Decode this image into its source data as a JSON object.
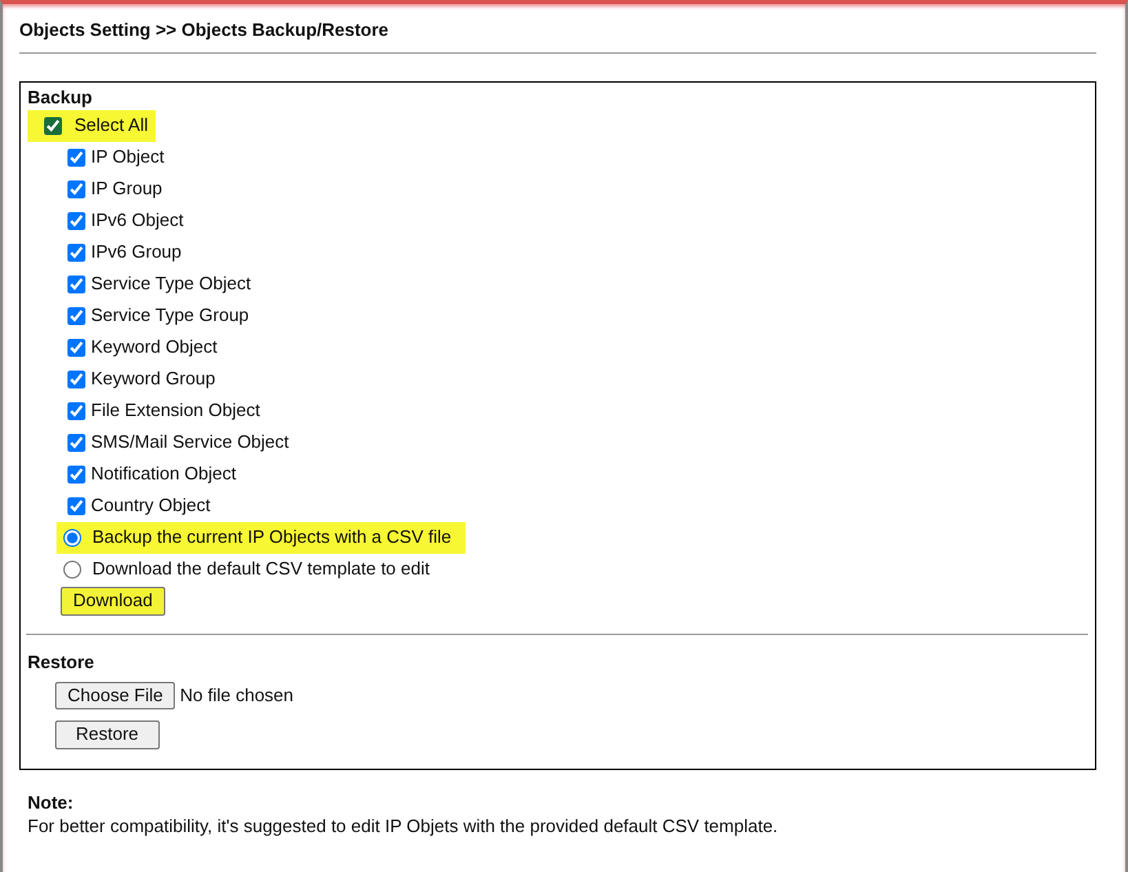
{
  "page_title": "Objects Setting >> Objects Backup/Restore",
  "backup": {
    "heading": "Backup",
    "select_all": {
      "label": "Select All",
      "checked": true,
      "highlighted": true
    },
    "objects": [
      {
        "label": "IP Object",
        "checked": true
      },
      {
        "label": "IP Group",
        "checked": true
      },
      {
        "label": "IPv6 Object",
        "checked": true
      },
      {
        "label": "IPv6 Group",
        "checked": true
      },
      {
        "label": "Service Type Object",
        "checked": true
      },
      {
        "label": "Service Type Group",
        "checked": true
      },
      {
        "label": "Keyword Object",
        "checked": true
      },
      {
        "label": "Keyword Group",
        "checked": true
      },
      {
        "label": "File Extension Object",
        "checked": true
      },
      {
        "label": "SMS/Mail Service Object",
        "checked": true
      },
      {
        "label": "Notification Object",
        "checked": true
      },
      {
        "label": "Country Object",
        "checked": true
      }
    ],
    "options": [
      {
        "label": "Backup the current IP Objects with a CSV file",
        "selected": true,
        "highlighted": true
      },
      {
        "label": "Download the default CSV template to edit",
        "selected": false,
        "highlighted": false
      }
    ],
    "download_button": {
      "label": "Download",
      "highlighted": true
    }
  },
  "restore": {
    "heading": "Restore",
    "choose_button": "Choose File",
    "file_status": "No file chosen",
    "restore_button": "Restore"
  },
  "note": {
    "heading": "Note:",
    "text": "For better compatibility, it's suggested to edit IP Objets with the provided default CSV template."
  }
}
